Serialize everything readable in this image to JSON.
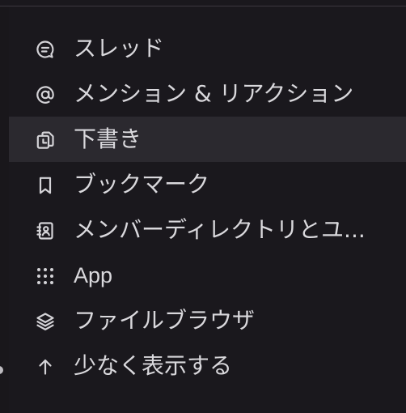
{
  "menu": {
    "items": [
      {
        "label": "スレッド",
        "icon": "threads-icon"
      },
      {
        "label": "メンション & リアクション",
        "icon": "at-sign-icon"
      },
      {
        "label": "下書き",
        "icon": "drafts-icon"
      },
      {
        "label": "ブックマーク",
        "icon": "bookmark-icon"
      },
      {
        "label": "メンバーディレクトリとユ...",
        "icon": "member-directory-icon"
      },
      {
        "label": "App",
        "icon": "apps-grid-icon"
      },
      {
        "label": "ファイルブラウザ",
        "icon": "layers-icon"
      },
      {
        "label": "少なく表示する",
        "icon": "arrow-up-icon"
      }
    ],
    "active_index": 2
  },
  "colors": {
    "background": "#1a181d",
    "active_row": "#2b292f",
    "text": "#d9d8dc"
  }
}
